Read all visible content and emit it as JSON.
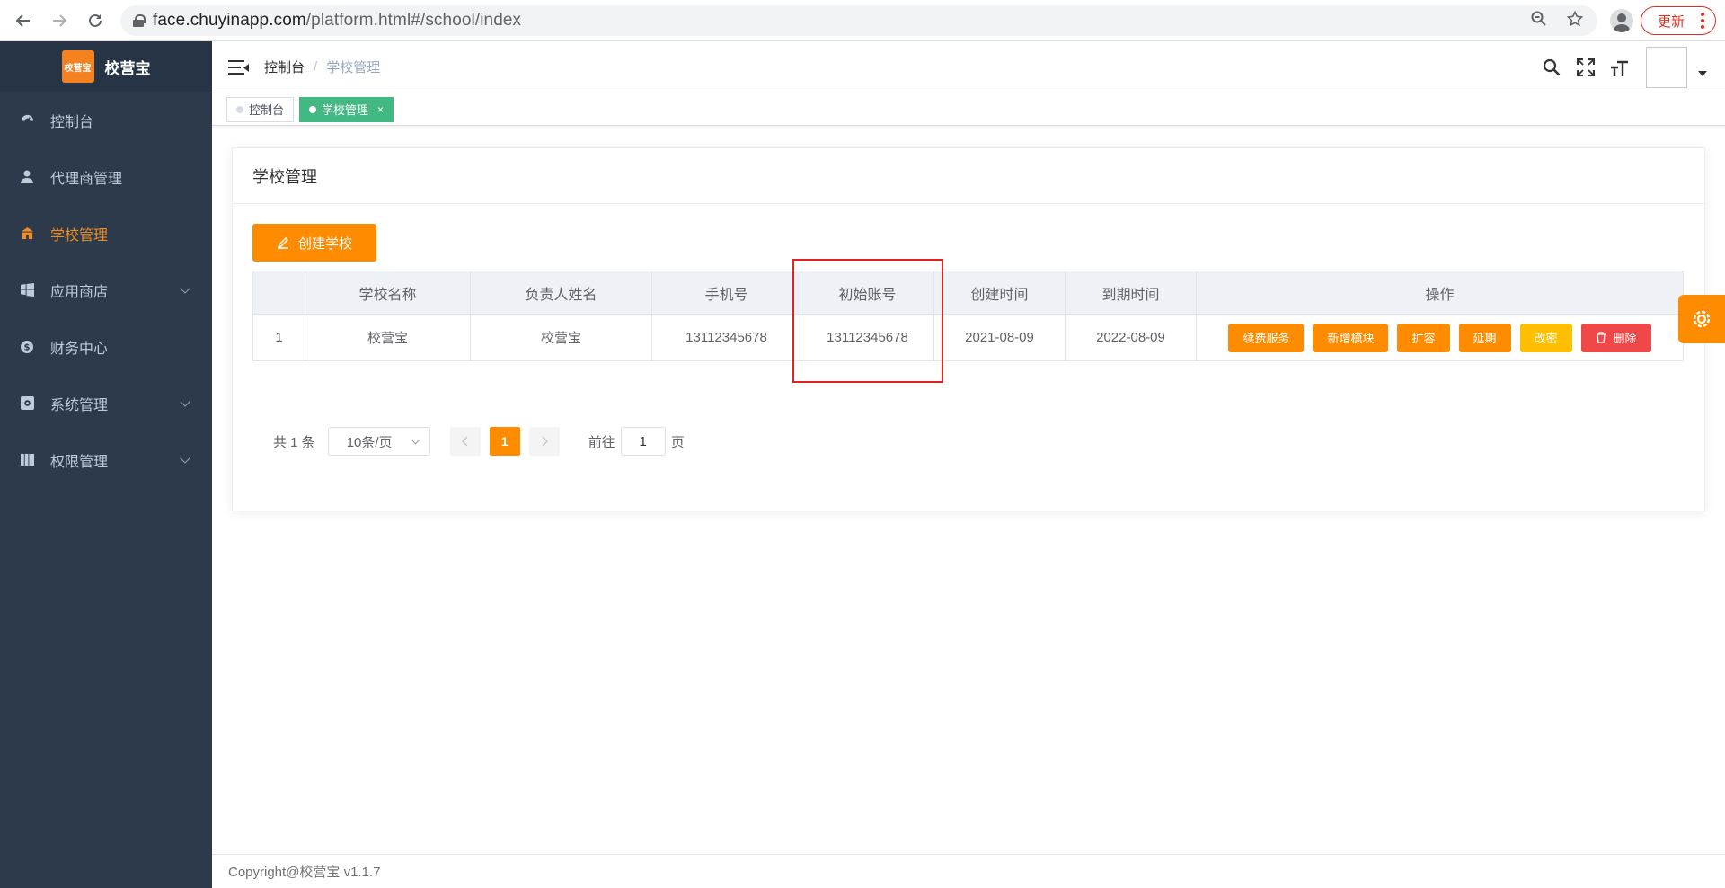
{
  "browser": {
    "url_host": "face.chuyinapp.com",
    "url_path": "/platform.html#/school/index",
    "update_label": "更新"
  },
  "sidebar": {
    "logo_text": "校营宝",
    "logo_badge": "校营宝",
    "items": [
      {
        "label": "控制台",
        "icon": "dashboard-icon"
      },
      {
        "label": "代理商管理",
        "icon": "user-icon"
      },
      {
        "label": "学校管理",
        "icon": "school-icon"
      },
      {
        "label": "应用商店",
        "icon": "windows-icon"
      },
      {
        "label": "财务中心",
        "icon": "coin-icon"
      },
      {
        "label": "系统管理",
        "icon": "settings-box-icon"
      },
      {
        "label": "权限管理",
        "icon": "bars-icon"
      }
    ]
  },
  "navbar": {
    "breadcrumb_home": "控制台",
    "breadcrumb_sep": "/",
    "breadcrumb_current": "学校管理"
  },
  "tags": {
    "tag1": "控制台",
    "tag2": "学校管理",
    "close": "×"
  },
  "card": {
    "title": "学校管理",
    "create_label": "创建学校"
  },
  "table": {
    "headers": [
      "",
      "学校名称",
      "负责人姓名",
      "手机号",
      "初始账号",
      "创建时间",
      "到期时间",
      "操作"
    ],
    "rows": [
      {
        "index": "1",
        "school": "校营宝",
        "manager": "校营宝",
        "phone": "13112345678",
        "account": "13112345678",
        "created": "2021-08-09",
        "expires": "2022-08-09"
      }
    ],
    "ops": [
      "续费服务",
      "新增模块",
      "扩容",
      "延期",
      "改密",
      "删除"
    ]
  },
  "pagination": {
    "total": "共 1 条",
    "page_size": "10条/页",
    "current_page": "1",
    "goto_label": "前往",
    "goto_value": "1",
    "page_unit": "页"
  },
  "footer": {
    "copyright": "Copyright@校营宝 v1.1.7"
  },
  "colors": {
    "accent": "#ff8c00",
    "sidebar_bg": "#2d3a4b",
    "active_tag": "#42b983",
    "danger": "#f04848",
    "highlight_box": "#e42121"
  }
}
